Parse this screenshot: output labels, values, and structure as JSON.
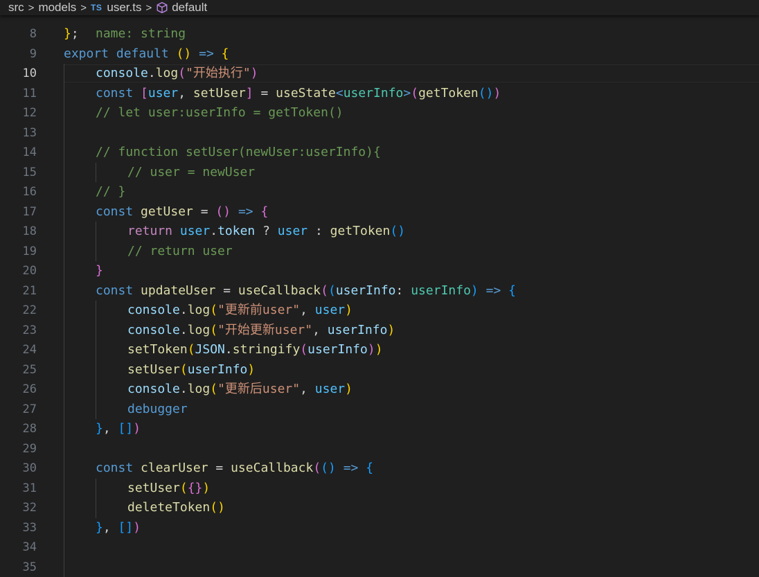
{
  "breadcrumb": {
    "items": [
      "src",
      "models",
      "user.ts",
      "default"
    ],
    "file_badge": "TS",
    "symbol_icon": "symbol-module-icon"
  },
  "editor": {
    "active_line": 10,
    "partial_top_line": "name: string",
    "lines": [
      {
        "n": 8,
        "indent": 0,
        "tokens": [
          [
            "}",
            "b1"
          ],
          [
            ";",
            "pun"
          ]
        ]
      },
      {
        "n": 9,
        "indent": 0,
        "tokens": [
          [
            "export",
            "kw"
          ],
          [
            " ",
            "pun"
          ],
          [
            "default",
            "kw"
          ],
          [
            " ",
            "pun"
          ],
          [
            "(",
            "b1"
          ],
          [
            ")",
            "b1"
          ],
          [
            " ",
            "pun"
          ],
          [
            "=>",
            "kw"
          ],
          [
            " ",
            "pun"
          ],
          [
            "{",
            "b1"
          ]
        ]
      },
      {
        "n": 10,
        "indent": 1,
        "tokens": [
          [
            "console",
            "var"
          ],
          [
            ".",
            "pun"
          ],
          [
            "log",
            "fn"
          ],
          [
            "(",
            "b2"
          ],
          [
            "\"开始执行\"",
            "str"
          ],
          [
            ")",
            "b2"
          ]
        ]
      },
      {
        "n": 11,
        "indent": 1,
        "tokens": [
          [
            "const",
            "kw"
          ],
          [
            " ",
            "pun"
          ],
          [
            "[",
            "b2"
          ],
          [
            "user",
            "cst"
          ],
          [
            ", ",
            "pun"
          ],
          [
            "setUser",
            "fn"
          ],
          [
            "]",
            "b2"
          ],
          [
            " = ",
            "pun"
          ],
          [
            "useState",
            "fn"
          ],
          [
            "<",
            "kw"
          ],
          [
            "userInfo",
            "typ"
          ],
          [
            ">",
            "kw"
          ],
          [
            "(",
            "b2"
          ],
          [
            "getToken",
            "fn"
          ],
          [
            "(",
            "b3"
          ],
          [
            ")",
            "b3"
          ],
          [
            ")",
            "b2"
          ]
        ]
      },
      {
        "n": 12,
        "indent": 1,
        "tokens": [
          [
            "// let user:userInfo = getToken()",
            "cmt"
          ]
        ]
      },
      {
        "n": 13,
        "indent": 1,
        "tokens": []
      },
      {
        "n": 14,
        "indent": 1,
        "tokens": [
          [
            "// function setUser(newUser:userInfo){",
            "cmt"
          ]
        ]
      },
      {
        "n": 15,
        "indent": 2,
        "tokens": [
          [
            "// user = newUser",
            "cmt"
          ]
        ]
      },
      {
        "n": 16,
        "indent": 1,
        "tokens": [
          [
            "// }",
            "cmt"
          ]
        ]
      },
      {
        "n": 17,
        "indent": 1,
        "tokens": [
          [
            "const",
            "kw"
          ],
          [
            " ",
            "pun"
          ],
          [
            "getUser",
            "fn"
          ],
          [
            " = ",
            "pun"
          ],
          [
            "(",
            "b2"
          ],
          [
            ")",
            "b2"
          ],
          [
            " ",
            "pun"
          ],
          [
            "=>",
            "kw"
          ],
          [
            " ",
            "pun"
          ],
          [
            "{",
            "b2"
          ]
        ]
      },
      {
        "n": 18,
        "indent": 2,
        "tokens": [
          [
            "return",
            "ctl"
          ],
          [
            " ",
            "pun"
          ],
          [
            "user",
            "cst"
          ],
          [
            ".",
            "pun"
          ],
          [
            "token",
            "var"
          ],
          [
            " ? ",
            "pun"
          ],
          [
            "user",
            "cst"
          ],
          [
            " : ",
            "pun"
          ],
          [
            "getToken",
            "fn"
          ],
          [
            "(",
            "b3"
          ],
          [
            ")",
            "b3"
          ]
        ]
      },
      {
        "n": 19,
        "indent": 2,
        "tokens": [
          [
            "// return user",
            "cmt"
          ]
        ]
      },
      {
        "n": 20,
        "indent": 1,
        "tokens": [
          [
            "}",
            "b2"
          ]
        ]
      },
      {
        "n": 21,
        "indent": 1,
        "tokens": [
          [
            "const",
            "kw"
          ],
          [
            " ",
            "pun"
          ],
          [
            "updateUser",
            "fn"
          ],
          [
            " = ",
            "pun"
          ],
          [
            "useCallback",
            "fn"
          ],
          [
            "(",
            "b2"
          ],
          [
            "(",
            "b3"
          ],
          [
            "userInfo",
            "var"
          ],
          [
            ": ",
            "pun"
          ],
          [
            "userInfo",
            "typ"
          ],
          [
            ")",
            "b3"
          ],
          [
            " ",
            "pun"
          ],
          [
            "=>",
            "kw"
          ],
          [
            " ",
            "pun"
          ],
          [
            "{",
            "b3"
          ]
        ]
      },
      {
        "n": 22,
        "indent": 2,
        "tokens": [
          [
            "console",
            "var"
          ],
          [
            ".",
            "pun"
          ],
          [
            "log",
            "fn"
          ],
          [
            "(",
            "b1"
          ],
          [
            "\"更新前user\"",
            "str"
          ],
          [
            ", ",
            "pun"
          ],
          [
            "user",
            "cst"
          ],
          [
            ")",
            "b1"
          ]
        ]
      },
      {
        "n": 23,
        "indent": 2,
        "tokens": [
          [
            "console",
            "var"
          ],
          [
            ".",
            "pun"
          ],
          [
            "log",
            "fn"
          ],
          [
            "(",
            "b1"
          ],
          [
            "\"开始更新user\"",
            "str"
          ],
          [
            ", ",
            "pun"
          ],
          [
            "userInfo",
            "var"
          ],
          [
            ")",
            "b1"
          ]
        ]
      },
      {
        "n": 24,
        "indent": 2,
        "tokens": [
          [
            "setToken",
            "fn"
          ],
          [
            "(",
            "b1"
          ],
          [
            "JSON",
            "var"
          ],
          [
            ".",
            "pun"
          ],
          [
            "stringify",
            "fn"
          ],
          [
            "(",
            "b2"
          ],
          [
            "userInfo",
            "var"
          ],
          [
            ")",
            "b2"
          ],
          [
            ")",
            "b1"
          ]
        ]
      },
      {
        "n": 25,
        "indent": 2,
        "tokens": [
          [
            "setUser",
            "fn"
          ],
          [
            "(",
            "b1"
          ],
          [
            "userInfo",
            "var"
          ],
          [
            ")",
            "b1"
          ]
        ]
      },
      {
        "n": 26,
        "indent": 2,
        "tokens": [
          [
            "console",
            "var"
          ],
          [
            ".",
            "pun"
          ],
          [
            "log",
            "fn"
          ],
          [
            "(",
            "b1"
          ],
          [
            "\"更新后user\"",
            "str"
          ],
          [
            ", ",
            "pun"
          ],
          [
            "user",
            "cst"
          ],
          [
            ")",
            "b1"
          ]
        ]
      },
      {
        "n": 27,
        "indent": 2,
        "tokens": [
          [
            "debugger",
            "kw"
          ]
        ]
      },
      {
        "n": 28,
        "indent": 1,
        "tokens": [
          [
            "}",
            "b3"
          ],
          [
            ", ",
            "pun"
          ],
          [
            "[",
            "b3"
          ],
          [
            "]",
            "b3"
          ],
          [
            ")",
            "b2"
          ]
        ]
      },
      {
        "n": 29,
        "indent": 1,
        "tokens": []
      },
      {
        "n": 30,
        "indent": 1,
        "tokens": [
          [
            "const",
            "kw"
          ],
          [
            " ",
            "pun"
          ],
          [
            "clearUser",
            "fn"
          ],
          [
            " = ",
            "pun"
          ],
          [
            "useCallback",
            "fn"
          ],
          [
            "(",
            "b2"
          ],
          [
            "(",
            "b3"
          ],
          [
            ")",
            "b3"
          ],
          [
            " ",
            "pun"
          ],
          [
            "=>",
            "kw"
          ],
          [
            " ",
            "pun"
          ],
          [
            "{",
            "b3"
          ]
        ]
      },
      {
        "n": 31,
        "indent": 2,
        "tokens": [
          [
            "setUser",
            "fn"
          ],
          [
            "(",
            "b1"
          ],
          [
            "{",
            "b2"
          ],
          [
            "}",
            "b2"
          ],
          [
            ")",
            "b1"
          ]
        ]
      },
      {
        "n": 32,
        "indent": 2,
        "tokens": [
          [
            "deleteToken",
            "fn"
          ],
          [
            "(",
            "b1"
          ],
          [
            ")",
            "b1"
          ]
        ]
      },
      {
        "n": 33,
        "indent": 1,
        "tokens": [
          [
            "}",
            "b3"
          ],
          [
            ", ",
            "pun"
          ],
          [
            "[",
            "b3"
          ],
          [
            "]",
            "b3"
          ],
          [
            ")",
            "b2"
          ]
        ]
      },
      {
        "n": 34,
        "indent": 1,
        "tokens": []
      },
      {
        "n": 35,
        "indent": 1,
        "tokens": []
      }
    ]
  },
  "colors": {
    "background": "#1f1f1f",
    "keyword": "#569cd6",
    "control": "#c586c0",
    "function": "#dcdcaa",
    "variable": "#9cdcfe",
    "constant": "#4fc1ff",
    "type": "#4ec9b0",
    "string": "#ce9178",
    "comment": "#6a9955"
  }
}
